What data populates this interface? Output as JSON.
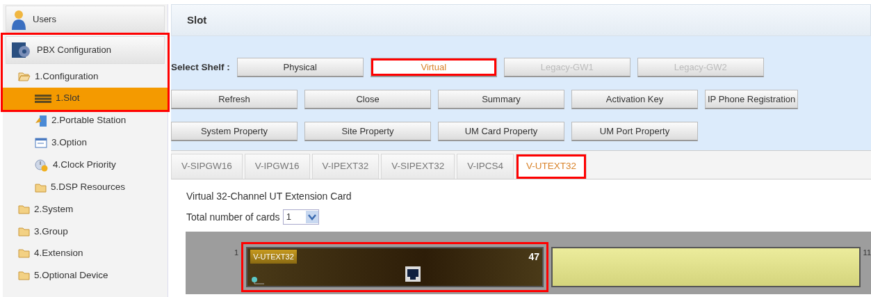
{
  "sidebar": {
    "highlighted": true,
    "sections": [
      {
        "label": "Users"
      },
      {
        "label": "PBX Configuration"
      }
    ],
    "tree": [
      {
        "label": "1.Configuration",
        "expanded": true,
        "children": [
          {
            "label": "1.Slot",
            "selected": true
          },
          {
            "label": "2.Portable Station",
            "selected": false
          },
          {
            "label": "3.Option",
            "selected": false
          },
          {
            "label": "4.Clock Priority",
            "selected": false
          },
          {
            "label": "5.DSP Resources",
            "selected": false
          }
        ]
      },
      {
        "label": "2.System",
        "expanded": false
      },
      {
        "label": "3.Group",
        "expanded": false
      },
      {
        "label": "4.Extension",
        "expanded": false
      },
      {
        "label": "5.Optional Device",
        "expanded": false
      }
    ]
  },
  "page_title": "Slot",
  "shelf": {
    "label": "Select Shelf :",
    "options": [
      {
        "label": "Physical",
        "selected": false,
        "disabled": false,
        "highlighted": false
      },
      {
        "label": "Virtual",
        "selected": true,
        "disabled": false,
        "highlighted": true
      },
      {
        "label": "Legacy-GW1",
        "selected": false,
        "disabled": true,
        "highlighted": false
      },
      {
        "label": "Legacy-GW2",
        "selected": false,
        "disabled": true,
        "highlighted": false
      }
    ]
  },
  "button_rows": [
    [
      "Refresh",
      "Close",
      "Summary",
      "Activation Key",
      "IP Phone Registration"
    ],
    [
      "System Property",
      "Site Property",
      "UM Card Property",
      "UM Port Property"
    ]
  ],
  "tabs": [
    {
      "label": "V-SIPGW16",
      "selected": false,
      "highlighted": false
    },
    {
      "label": "V-IPGW16",
      "selected": false,
      "highlighted": false
    },
    {
      "label": "V-IPEXT32",
      "selected": false,
      "highlighted": false
    },
    {
      "label": "V-SIPEXT32",
      "selected": false,
      "highlighted": false
    },
    {
      "label": "V-IPCS4",
      "selected": false,
      "highlighted": false
    },
    {
      "label": "V-UTEXT32",
      "selected": true,
      "highlighted": true
    }
  ],
  "card_title": "Virtual 32-Channel UT Extension Card",
  "card_count": {
    "label": "Total number of cards",
    "value": "1"
  },
  "slots": [
    {
      "number": "1",
      "kind": "card",
      "name": "V-UTEXT32",
      "count": "47",
      "highlighted": true
    },
    {
      "number": "11",
      "kind": "empty"
    }
  ]
}
